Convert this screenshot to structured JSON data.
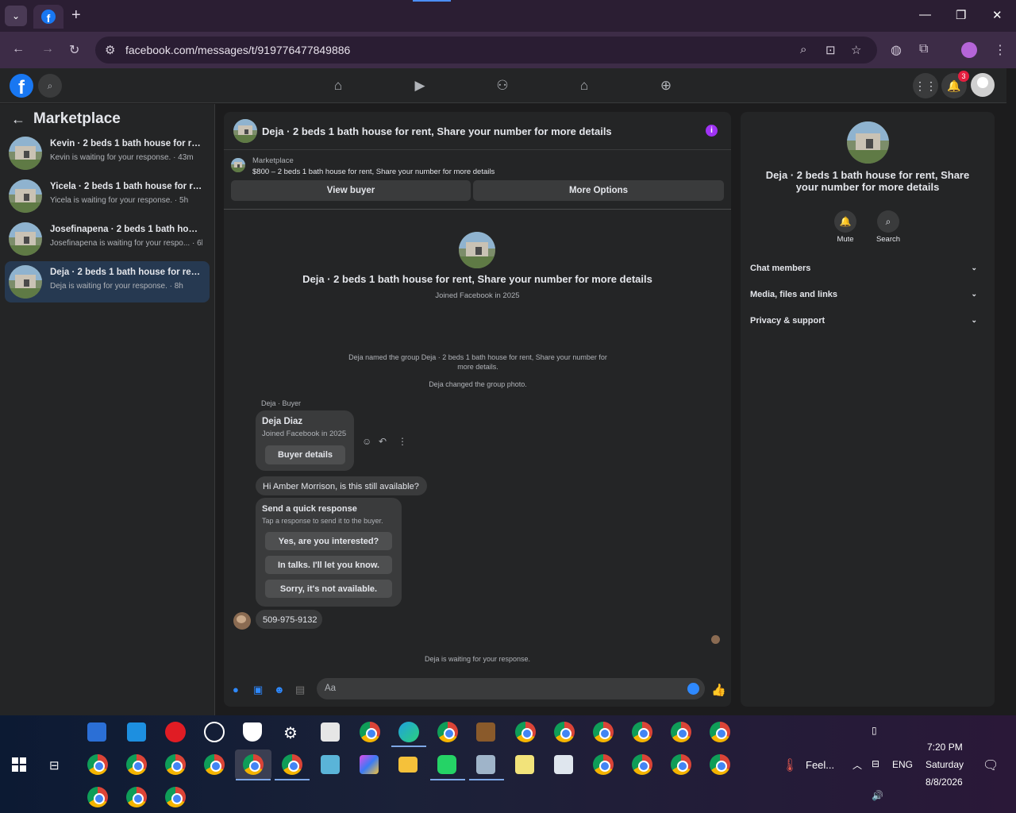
{
  "browser": {
    "url": "facebook.com/messages/t/919776477849886",
    "new_tab_label": "+",
    "window_controls": [
      "minimize",
      "restore",
      "close"
    ]
  },
  "fb_nav": {
    "icons": [
      "home-icon",
      "watch-icon",
      "friends-icon",
      "marketplace-icon",
      "gaming-icon"
    ],
    "notification_count": "3"
  },
  "left": {
    "title": "Marketplace",
    "conversations": [
      {
        "name": "Kevin · 2 beds 1 bath house for ren...",
        "sub": "Kevin is waiting for your response. · 43m",
        "active": false
      },
      {
        "name": "Yicela · 2 beds 1 bath house for re...",
        "sub": "Yicela is waiting for your response. · 5h",
        "active": false
      },
      {
        "name": "Josefinapena · 2 beds 1 bath house...",
        "sub": "Josefinapena is waiting for your respo... · 6h",
        "active": false
      },
      {
        "name": "Deja · 2 beds 1 bath house for rent...",
        "sub": "Deja is waiting for your response. · 8h",
        "active": true
      }
    ]
  },
  "chat": {
    "header_title": "Deja · 2 beds 1 bath house for rent, Share your number for more details",
    "marketplace_label": "Marketplace",
    "listing": "$800 – 2 beds 1 bath house for rent, Share your number for more details",
    "view_buyer": "View buyer",
    "more_options": "More Options",
    "intro_title": "Deja · 2 beds 1 bath house for rent, Share your number for more details",
    "intro_sub": "Joined Facebook in 2025",
    "system_1": "Deja named the group Deja · 2 beds 1 bath house for rent, Share your number for more details.",
    "system_2": "Deja changed the group photo.",
    "buyer_label": "Deja · Buyer",
    "buyer_name": "Deja Diaz",
    "buyer_joined": "Joined Facebook in 2025",
    "buyer_details": "Buyer details",
    "message_1": "Hi Amber Morrison, is this still available?",
    "quick_title": "Send a quick response",
    "quick_sub": "Tap a response to send it to the buyer.",
    "quick_replies": [
      "Yes, are you interested?",
      "In talks. I'll let you know.",
      "Sorry, it's not available."
    ],
    "message_2": "509-975-9132",
    "waiting": "Deja is waiting for your response.",
    "composer_placeholder": "Aa"
  },
  "right": {
    "title": "Deja · 2 beds 1 bath house for rent, Share your number for more details",
    "mute": "Mute",
    "search": "Search",
    "sections": [
      "Chat members",
      "Media, files and links",
      "Privacy & support"
    ]
  },
  "taskbar": {
    "weather": "Feel...",
    "lang": "ENG",
    "time": "7:20 PM",
    "day": "Saturday",
    "date": "8/8/2026"
  },
  "colors": {
    "accent": "#1877f2",
    "active_conv": "#263951",
    "messenger_blue": "#2e89ff",
    "info_purple": "#a033f5"
  }
}
